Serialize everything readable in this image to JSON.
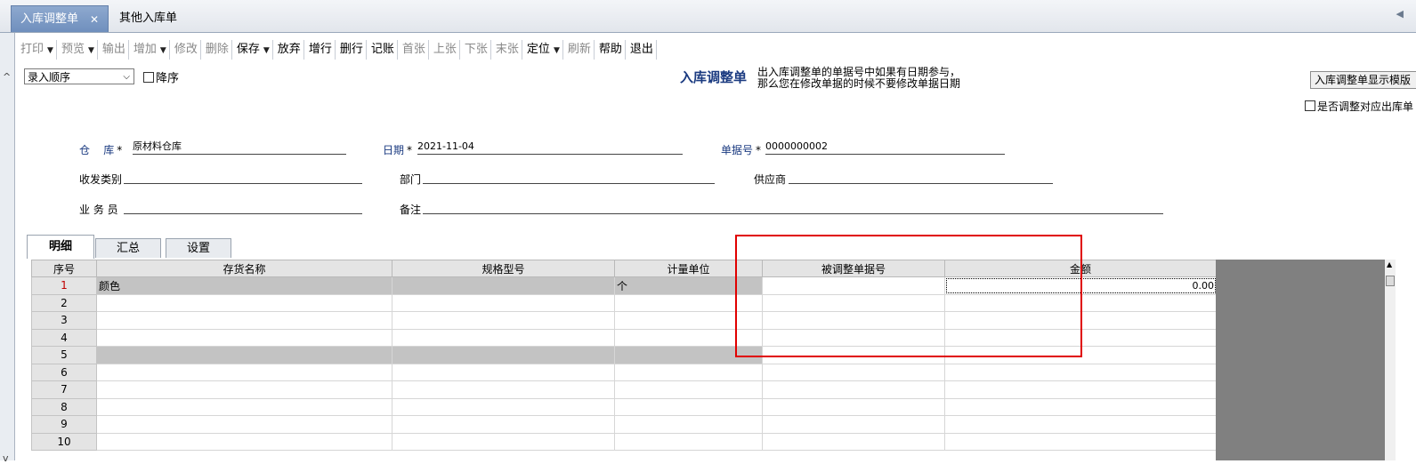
{
  "doc_tabs": {
    "active": "入库调整单",
    "close": "✕",
    "other": "其他入库单",
    "scroll_left": "◀"
  },
  "left_strip": {
    "up": "^",
    "down": "v"
  },
  "toolbar": [
    {
      "label": "打印",
      "dropdown": true,
      "enabled": false
    },
    {
      "label": "预览",
      "dropdown": true,
      "enabled": false
    },
    {
      "label": "输出",
      "dropdown": false,
      "enabled": false
    },
    {
      "label": "增加",
      "dropdown": true,
      "enabled": false
    },
    {
      "label": "修改",
      "dropdown": false,
      "enabled": false
    },
    {
      "label": "删除",
      "dropdown": false,
      "enabled": false
    },
    {
      "label": "保存",
      "dropdown": true,
      "enabled": true
    },
    {
      "label": "放弃",
      "dropdown": false,
      "enabled": true
    },
    {
      "label": "增行",
      "dropdown": false,
      "enabled": true
    },
    {
      "label": "删行",
      "dropdown": false,
      "enabled": true
    },
    {
      "label": "记账",
      "dropdown": false,
      "enabled": true
    },
    {
      "label": "首张",
      "dropdown": false,
      "enabled": false
    },
    {
      "label": "上张",
      "dropdown": false,
      "enabled": false
    },
    {
      "label": "下张",
      "dropdown": false,
      "enabled": false
    },
    {
      "label": "末张",
      "dropdown": false,
      "enabled": false
    },
    {
      "label": "定位",
      "dropdown": true,
      "enabled": true
    },
    {
      "label": "刷新",
      "dropdown": false,
      "enabled": false
    },
    {
      "label": "帮助",
      "dropdown": false,
      "enabled": true
    },
    {
      "label": "退出",
      "dropdown": false,
      "enabled": true
    }
  ],
  "header": {
    "order_select": "录入顺序",
    "descending_label": "降序",
    "title": "入库调整单",
    "hint_line1": "出入库调整单的单据号中如果有日期参与，",
    "hint_line2": "那么您在修改单据的时候不要修改单据日期",
    "display_button": "入库调整单显示模版",
    "adjust_checkbox_label": "是否调整对应出库单"
  },
  "form": {
    "warehouse_label": "仓    库",
    "warehouse_value": "原材料仓库",
    "date_label": "日期",
    "date_value": "2021-11-04",
    "docno_label": "单据号",
    "docno_value": "0000000002",
    "category_label": "收发类别",
    "category_value": "",
    "dept_label": "部门",
    "dept_value": "",
    "supplier_label": "供应商",
    "supplier_value": "",
    "clerk_label": "业 务 员",
    "clerk_value": "",
    "remark_label": "备注",
    "remark_value": "",
    "required_mark": "*"
  },
  "grid_tabs": [
    "明细",
    "汇总",
    "设置"
  ],
  "table": {
    "columns": [
      "序号",
      "存货名称",
      "规格型号",
      "计量单位",
      "被调整单据号",
      "金额"
    ],
    "rows": [
      {
        "no": "1",
        "name": "颜色",
        "spec": "",
        "unit": "个",
        "ref": "",
        "amount": "0.00"
      },
      {
        "no": "2",
        "name": "",
        "spec": "",
        "unit": "",
        "ref": "",
        "amount": ""
      },
      {
        "no": "3",
        "name": "",
        "spec": "",
        "unit": "",
        "ref": "",
        "amount": ""
      },
      {
        "no": "4",
        "name": "",
        "spec": "",
        "unit": "",
        "ref": "",
        "amount": ""
      },
      {
        "no": "5",
        "name": "",
        "spec": "",
        "unit": "",
        "ref": "",
        "amount": ""
      },
      {
        "no": "6",
        "name": "",
        "spec": "",
        "unit": "",
        "ref": "",
        "amount": ""
      },
      {
        "no": "7",
        "name": "",
        "spec": "",
        "unit": "",
        "ref": "",
        "amount": ""
      },
      {
        "no": "8",
        "name": "",
        "spec": "",
        "unit": "",
        "ref": "",
        "amount": ""
      },
      {
        "no": "9",
        "name": "",
        "spec": "",
        "unit": "",
        "ref": "",
        "amount": ""
      },
      {
        "no": "10",
        "name": "",
        "spec": "",
        "unit": "",
        "ref": "",
        "amount": ""
      }
    ]
  },
  "colors": {
    "highlight": "#e00000",
    "title": "#1a3a80",
    "tab_active": "#7d9ac6",
    "row_selected": "#c3c3c3"
  }
}
